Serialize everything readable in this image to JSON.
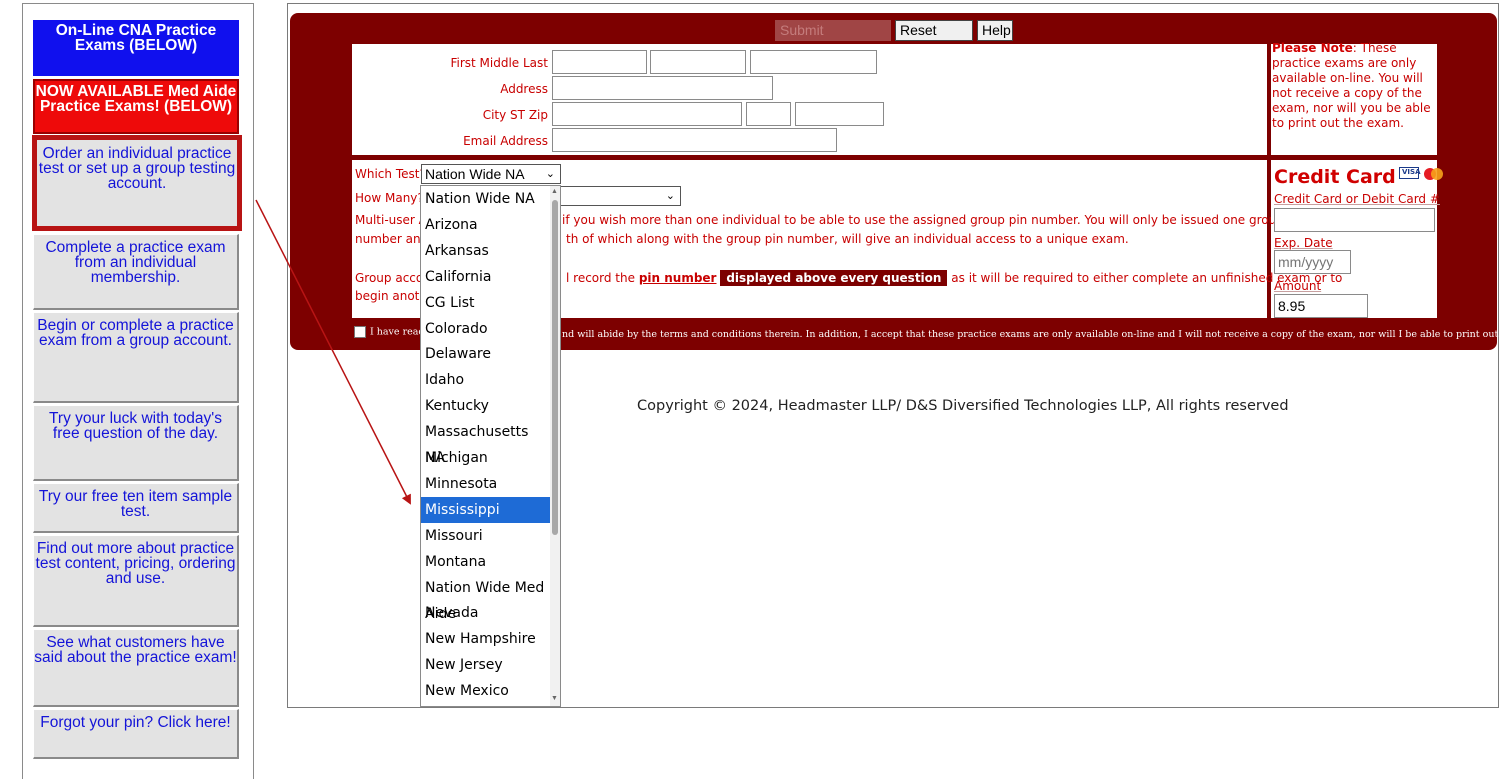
{
  "sidebar": {
    "banner_cna": "On-Line CNA Practice Exams (BELOW)",
    "banner_med": "NOW AVAILABLE Med Aide Practice Exams! (BELOW)",
    "buttons": [
      "Order an individual practice test or set up a group testing account.",
      "Complete a practice exam from an individual membership.",
      "Begin or complete a practice exam from a group account.",
      "Try your luck with today's free question of the day.",
      "Try our free ten item sample test.",
      "Find out more about practice test content, pricing, ordering and use.",
      "See what customers have said about the practice exam!",
      "Forgot your pin? Click here!"
    ]
  },
  "toolbar": {
    "submit_label": "Submit Registration",
    "reset_label": "Reset Fields",
    "help_label": "Help"
  },
  "form": {
    "name_label": "First Middle Last",
    "address_label": "Address",
    "city_label": "City ST Zip",
    "email_label": "Email Address",
    "note_bold": "Please Note",
    "note_text": ": These practice exams are only available on-line. You will not receive a copy of the exam, nor will you be able to print out the exam.",
    "which_test_label": "Which Test?",
    "which_test_value": "Nation Wide NA",
    "how_many_label": "How Many?",
    "multi_user_prefix": "Multi-user Ac",
    "multi_user_rest1": " if you wish more than one individual to be able to use the assigned group pin number. You will only be issued one group pin",
    "multi_user_line2a": "number and",
    "multi_user_line2b": "th of which along with the group pin number, will give an individual access to a unique exam.",
    "group_prefix": "Group accou",
    "group_mid": "l record the ",
    "pin_number": "pin number",
    "displayed": "displayed above every question",
    "group_rest": " as it will be required to either complete an unfinished exam or to",
    "group_line2": "begin anothe",
    "agree_prefix": "I have read t",
    "agree_rest": "nd will abide by the terms and conditions therein. In addition, I accept that these practice exams are only available on-line and I will not receive a copy of the exam, nor will I be able to print out the exam."
  },
  "payment": {
    "title": "Credit Card",
    "card_label": "Credit Card or Debit Card #",
    "exp_label": "Exp. Date",
    "exp_placeholder": "mm/yyyy",
    "amount_label": "Amount",
    "amount_value": "8.95",
    "visa": "VISA",
    "mastercard": "MasterCard"
  },
  "dropdown": {
    "options": [
      "Nation Wide NA",
      "Arizona",
      "Arkansas",
      "California",
      "CG List",
      "Colorado",
      "Delaware",
      "Idaho",
      "Kentucky",
      "Massachusetts NA",
      "Michigan",
      "Minnesota",
      "Mississippi",
      "Missouri",
      "Montana",
      "Nation Wide Med Aide",
      "Nevada",
      "New Hampshire",
      "New Jersey",
      "New Mexico"
    ],
    "selected": "Mississippi"
  },
  "footer": {
    "copyright": "Copyright © 2024, Headmaster LLP/ D&S Diversified Technologies LLP, All rights reserved"
  },
  "colors": {
    "panel": "#7d0000",
    "text_red": "#c80000",
    "link_blue": "#1414d8",
    "highlight_blue": "#1e6bd6",
    "annotation_red": "#b81414"
  }
}
